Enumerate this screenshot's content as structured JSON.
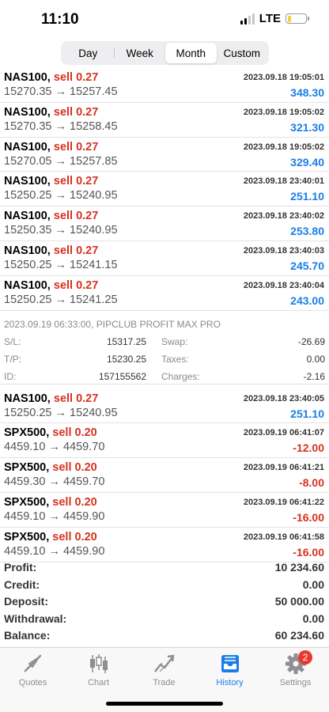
{
  "status": {
    "time": "11:10",
    "network": "LTE"
  },
  "segments": [
    "Day",
    "Week",
    "Month",
    "Custom"
  ],
  "active_segment": "Month",
  "trades_top": [
    {
      "symbol": "NAS100,",
      "side": "sell 0.27",
      "prices": "15270.35 → 15257.45",
      "date": "2023.09.18 19:05:01",
      "pl": "348.30",
      "sign": "pos"
    },
    {
      "symbol": "NAS100,",
      "side": "sell 0.27",
      "prices": "15270.35 → 15258.45",
      "date": "2023.09.18 19:05:02",
      "pl": "321.30",
      "sign": "pos"
    },
    {
      "symbol": "NAS100,",
      "side": "sell 0.27",
      "prices": "15270.05 → 15257.85",
      "date": "2023.09.18 19:05:02",
      "pl": "329.40",
      "sign": "pos"
    },
    {
      "symbol": "NAS100,",
      "side": "sell 0.27",
      "prices": "15250.25 → 15240.95",
      "date": "2023.09.18 23:40:01",
      "pl": "251.10",
      "sign": "pos"
    },
    {
      "symbol": "NAS100,",
      "side": "sell 0.27",
      "prices": "15250.35 → 15240.95",
      "date": "2023.09.18 23:40:02",
      "pl": "253.80",
      "sign": "pos"
    },
    {
      "symbol": "NAS100,",
      "side": "sell 0.27",
      "prices": "15250.25 → 15241.15",
      "date": "2023.09.18 23:40:03",
      "pl": "245.70",
      "sign": "pos"
    },
    {
      "symbol": "NAS100,",
      "side": "sell 0.27",
      "prices": "15250.25 → 15241.25",
      "date": "2023.09.18 23:40:04",
      "pl": "243.00",
      "sign": "pos"
    }
  ],
  "details": {
    "comment": "2023.09.19 06:33:00, PIPCLUB PROFIT MAX PRO",
    "rows": [
      {
        "l1": "S/L:",
        "v1": "15317.25",
        "l2": "Swap:",
        "v2": "-26.69"
      },
      {
        "l1": "T/P:",
        "v1": "15230.25",
        "l2": "Taxes:",
        "v2": "0.00"
      },
      {
        "l1": "ID:",
        "v1": "157155562",
        "l2": "Charges:",
        "v2": "-2.16"
      }
    ]
  },
  "trades_bottom": [
    {
      "symbol": "NAS100,",
      "side": "sell 0.27",
      "prices": "15250.25 → 15240.95",
      "date": "2023.09.18 23:40:05",
      "pl": "251.10",
      "sign": "pos"
    },
    {
      "symbol": "SPX500,",
      "side": "sell 0.20",
      "prices": "4459.10 → 4459.70",
      "date": "2023.09.19 06:41:07",
      "pl": "-12.00",
      "sign": "neg"
    },
    {
      "symbol": "SPX500,",
      "side": "sell 0.20",
      "prices": "4459.30 → 4459.70",
      "date": "2023.09.19 06:41:21",
      "pl": "-8.00",
      "sign": "neg"
    },
    {
      "symbol": "SPX500,",
      "side": "sell 0.20",
      "prices": "4459.10 → 4459.90",
      "date": "2023.09.19 06:41:22",
      "pl": "-16.00",
      "sign": "neg"
    },
    {
      "symbol": "SPX500,",
      "side": "sell 0.20",
      "prices": "4459.10 → 4459.90",
      "date": "2023.09.19 06:41:58",
      "pl": "-16.00",
      "sign": "neg"
    }
  ],
  "summary": [
    {
      "label": "Profit:",
      "value": "10 234.60"
    },
    {
      "label": "Credit:",
      "value": "0.00"
    },
    {
      "label": "Deposit:",
      "value": "50 000.00"
    },
    {
      "label": "Withdrawal:",
      "value": "0.00"
    },
    {
      "label": "Balance:",
      "value": "60 234.60"
    }
  ],
  "tabs": [
    {
      "label": "Quotes",
      "icon": "quotes-icon"
    },
    {
      "label": "Chart",
      "icon": "chart-icon"
    },
    {
      "label": "Trade",
      "icon": "trade-icon"
    },
    {
      "label": "History",
      "icon": "history-icon"
    },
    {
      "label": "Settings",
      "icon": "settings-icon",
      "badge": "2"
    }
  ],
  "active_tab": "History",
  "colors": {
    "accent": "#1a7ee8",
    "negative": "#d6321f",
    "badge": "#e8392e"
  }
}
